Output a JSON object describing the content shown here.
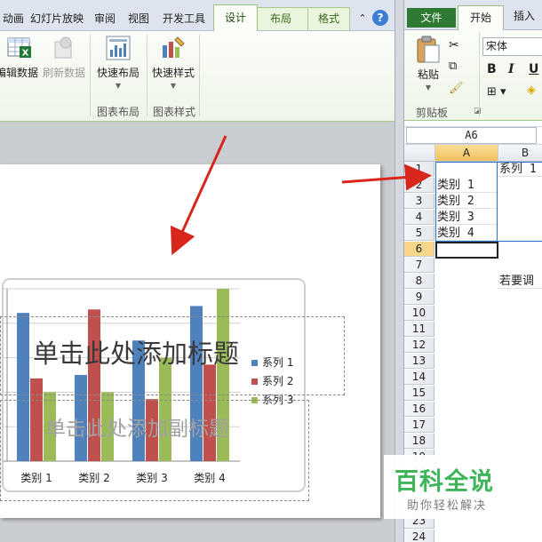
{
  "ppt": {
    "tabs": [
      "动画",
      "幻灯片放映",
      "审阅",
      "视图",
      "开发工具",
      "设计",
      "布局",
      "格式"
    ],
    "active_tab": "设计",
    "ribbon": {
      "edit_data": "编辑数据",
      "refresh_data": "刷新数据",
      "quick_layout": "快速布局",
      "quick_style": "快速样式",
      "group_chart_layout": "图表布局",
      "group_chart_style": "图表样式"
    },
    "slide": {
      "title_placeholder": "单击此处添加标题",
      "subtitle_placeholder": "单击此处添加副标题"
    }
  },
  "chart_data": {
    "type": "bar",
    "categories": [
      "类别 1",
      "类别 2",
      "类别 3",
      "类别 4"
    ],
    "series": [
      {
        "name": "系列 1",
        "color": "#4f81bd",
        "values": [
          4.3,
          2.5,
          3.5,
          4.5
        ]
      },
      {
        "name": "系列 2",
        "color": "#c0504d",
        "values": [
          2.4,
          4.4,
          1.8,
          2.8
        ]
      },
      {
        "name": "系列 3",
        "color": "#9bbb59",
        "values": [
          2.0,
          2.0,
          3.0,
          5.0
        ]
      }
    ],
    "ylim": [
      0,
      5
    ],
    "legend": "right"
  },
  "excel": {
    "tabs": {
      "file": "文件",
      "home": "开始",
      "insert": "插入"
    },
    "font_name": "宋体",
    "format_buttons": [
      "B",
      "I",
      "U"
    ],
    "paste_label": "粘贴",
    "clipboard_group": "剪贴板",
    "name_box": "A6",
    "columns": [
      "A",
      "B"
    ],
    "rows": [
      "1",
      "2",
      "3",
      "4",
      "5",
      "6",
      "7",
      "8",
      "9",
      "10",
      "11",
      "12",
      "13",
      "14",
      "15",
      "16",
      "17",
      "18",
      "19",
      "20",
      "21",
      "22",
      "23",
      "24"
    ],
    "cells": {
      "B1": "系列 1",
      "A2": "类别 1",
      "A3": "类别 2",
      "A4": "类别 3",
      "A5": "类别 4",
      "B8": "若要调"
    }
  },
  "watermark": {
    "main": "百科全说",
    "sub": "助你轻松解决"
  },
  "colors": {
    "arrow": "#d9261c",
    "accent_green": "#3eb55a"
  }
}
